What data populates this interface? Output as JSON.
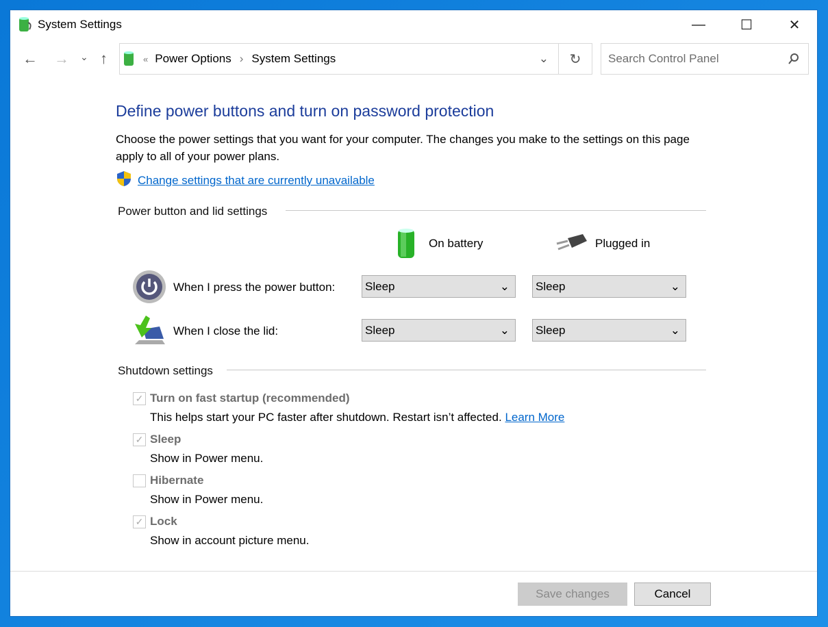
{
  "window": {
    "title": "System Settings",
    "minimize": "—",
    "maximize": "☐",
    "close": "✕"
  },
  "nav": {
    "back": "←",
    "forward": "→",
    "recent": "⌄",
    "up": "↑",
    "refresh": "↻",
    "breadcrumb_sep": "«",
    "crumbs": [
      "Power Options",
      "System Settings"
    ],
    "crumb_arrow": "›",
    "dropdown": "⌄"
  },
  "search": {
    "placeholder": "Search Control Panel",
    "icon": "search-icon"
  },
  "main": {
    "heading": "Define power buttons and turn on password protection",
    "description": "Choose the power settings that you want for your computer. The changes you make to the settings on this page apply to all of your power plans.",
    "change_link": "Change settings that are currently unavailable",
    "power_section": "Power button and lid settings",
    "columns": [
      "On battery",
      "Plugged in"
    ],
    "rows": [
      {
        "label": "When I press the power button:",
        "battery": "Sleep",
        "plugged": "Sleep"
      },
      {
        "label": "When I close the lid:",
        "battery": "Sleep",
        "plugged": "Sleep"
      }
    ],
    "shutdown_section": "Shutdown settings",
    "options": [
      {
        "label": "Turn on fast startup (recommended)",
        "desc": "This helps start your PC faster after shutdown. Restart isn’t affected.",
        "link": "Learn More",
        "checked": true
      },
      {
        "label": "Sleep",
        "desc": "Show in Power menu.",
        "checked": true
      },
      {
        "label": "Hibernate",
        "desc": "Show in Power menu.",
        "checked": false
      },
      {
        "label": "Lock",
        "desc": "Show in account picture menu.",
        "checked": true
      }
    ]
  },
  "footer": {
    "save": "Save changes",
    "cancel": "Cancel"
  },
  "colors": {
    "heading": "#1c3d9b",
    "link": "#0066cc",
    "desktop": "#0a78d7"
  }
}
